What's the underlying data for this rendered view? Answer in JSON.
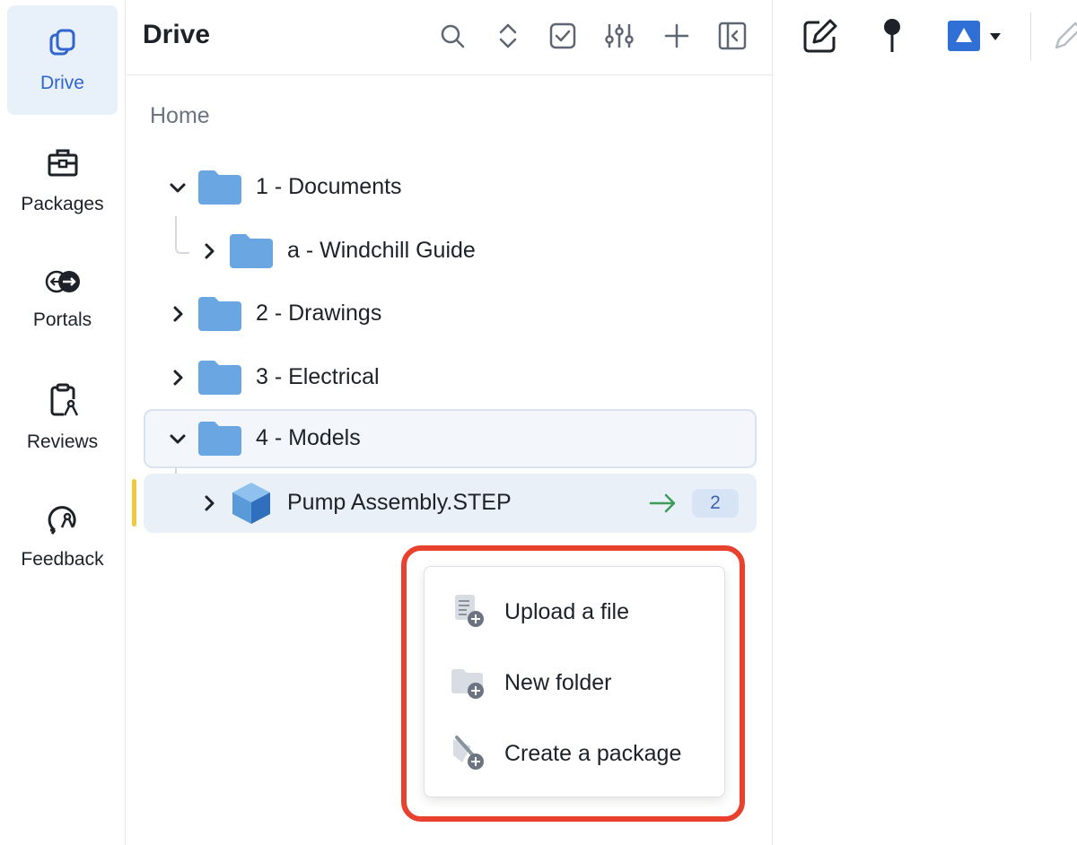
{
  "rail": {
    "items": [
      {
        "label": "Drive",
        "icon": "drive-icon",
        "active": true
      },
      {
        "label": "Packages",
        "icon": "briefcase-icon"
      },
      {
        "label": "Portals",
        "icon": "portal-icon"
      },
      {
        "label": "Reviews",
        "icon": "review-clipboard-icon"
      },
      {
        "label": "Feedback",
        "icon": "feedback-icon"
      }
    ]
  },
  "panel": {
    "title": "Drive",
    "toolbar_icons": [
      "search-icon",
      "expand-collapse-icon",
      "select-checkbox-icon",
      "filter-sliders-icon",
      "add-icon",
      "collapse-panel-icon"
    ],
    "breadcrumb": "Home"
  },
  "tree": {
    "items": [
      {
        "label": "1 - Documents",
        "expanded": true,
        "type": "folder"
      },
      {
        "label": "a - Windchill Guide",
        "expanded": false,
        "type": "folder"
      },
      {
        "label": "2 - Drawings",
        "expanded": false,
        "type": "folder"
      },
      {
        "label": "3 - Electrical",
        "expanded": false,
        "type": "folder"
      },
      {
        "label": "4 - Models",
        "expanded": true,
        "type": "folder"
      },
      {
        "label": "Pump Assembly.STEP",
        "expanded": false,
        "type": "model",
        "badge": "2"
      }
    ]
  },
  "context_menu": {
    "items": [
      {
        "label": "Upload a file",
        "icon": "upload-file-icon"
      },
      {
        "label": "New folder",
        "icon": "new-folder-icon"
      },
      {
        "label": "Create a package",
        "icon": "create-package-icon"
      }
    ]
  },
  "right_toolbar": {
    "icons": [
      "edit-icon",
      "pin-icon",
      "shape-triangle-icon",
      "dropdown-caret-icon",
      "pen-icon"
    ],
    "shape_color": "#2f6fd6"
  },
  "colors": {
    "accent": "#2f66d0",
    "folder": "#6aa7e2",
    "highlight": "#e8412e",
    "marker": "#f0c93f",
    "arrow": "#3e9b5a"
  }
}
